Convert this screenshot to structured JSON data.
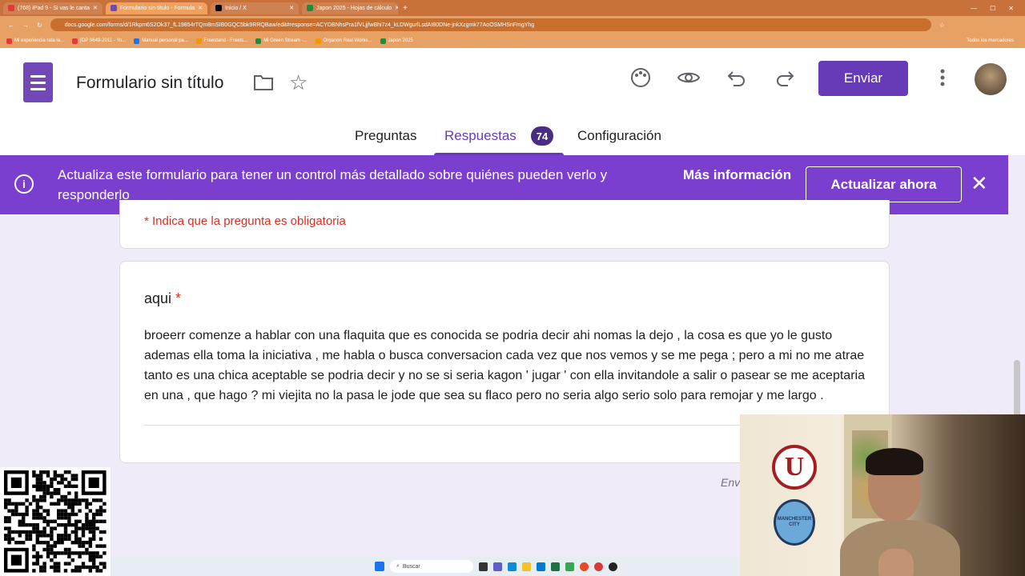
{
  "browser": {
    "tabs": [
      {
        "label": "(768) iPad 9 - Si vas le canta",
        "color": "#e53935",
        "active": false
      },
      {
        "label": "Formulario sin título - Formula",
        "color": "#7248b9",
        "active": true
      },
      {
        "label": "Inicio / X",
        "color": "#000000",
        "active": false
      },
      {
        "label": "Japon 2025 - Hojas de cálculo",
        "color": "#1e8e3e",
        "active": false
      }
    ],
    "new_tab": "+",
    "url": "docs.google.com/forms/d/1Rkpm6S2Ok37_fL19854rTQm8mSIB0GQC5bk9RRQBaw/edit#response=ACYDBNhsPra1fVLjjfwBhi7z4_kLDWgurlLsdAt80DNe-jnkXzgmk77AoOSMHSnFmgYhg",
    "bookmarks": [
      {
        "label": "Mi experiencia rata la...",
        "color": "#e53935"
      },
      {
        "label": "[OP 9649-2011 - Yo...",
        "color": "#e53935"
      },
      {
        "label": "Manual personal pa...",
        "color": "#1a73e8"
      },
      {
        "label": "Freestand - Freets...",
        "color": "#f29900"
      },
      {
        "label": "Mi Green Stream -...",
        "color": "#1e8e3e"
      },
      {
        "label": "Organon Real Works...",
        "color": "#f29900"
      },
      {
        "label": "Japon 2025",
        "color": "#1e8e3e"
      }
    ],
    "all_bookmarks": "Todos los marcadores"
  },
  "header": {
    "title": "Formulario sin título",
    "send_label": "Enviar",
    "icons": [
      "palette-icon",
      "eye-icon",
      "undo-icon",
      "redo-icon",
      "more-vert-icon"
    ]
  },
  "tabs": {
    "questions": "Preguntas",
    "responses": "Respuestas",
    "responses_count": "74",
    "settings": "Configuración"
  },
  "banner": {
    "text": "Actualiza este formulario para tener un control más detallado sobre quiénes pueden verlo y responderlo",
    "more_info": "Más información",
    "update_label": "Actualizar ahora",
    "close": "✕"
  },
  "form": {
    "required_note": "* Indica que la pregunta es obligatoria",
    "question_title": "aqui",
    "required_star": "*",
    "answer": "broeerr  comenze a hablar con una flaquita que es conocida se podria decir ahi nomas la dejo , la cosa es que yo le gusto ademas   ella toma la iniciativa , me habla o busca conversacion cada vez que nos vemos  y se me pega ; pero a mi no me atrae tanto es una chica aceptable se podria decir  y no se si seria kagon ' jugar ' con ella invitandole a salir o pasear se  me aceptaria en una , que hago ? mi viejita no la pasa le jode que sea su flaco pero no seria algo serio solo para  remojar  y me largo .",
    "footer_partial": "Env"
  },
  "taskbar": {
    "search": "Buscar"
  },
  "webcam": {
    "logo1": "U",
    "logo2": "MANCHESTER CITY"
  }
}
